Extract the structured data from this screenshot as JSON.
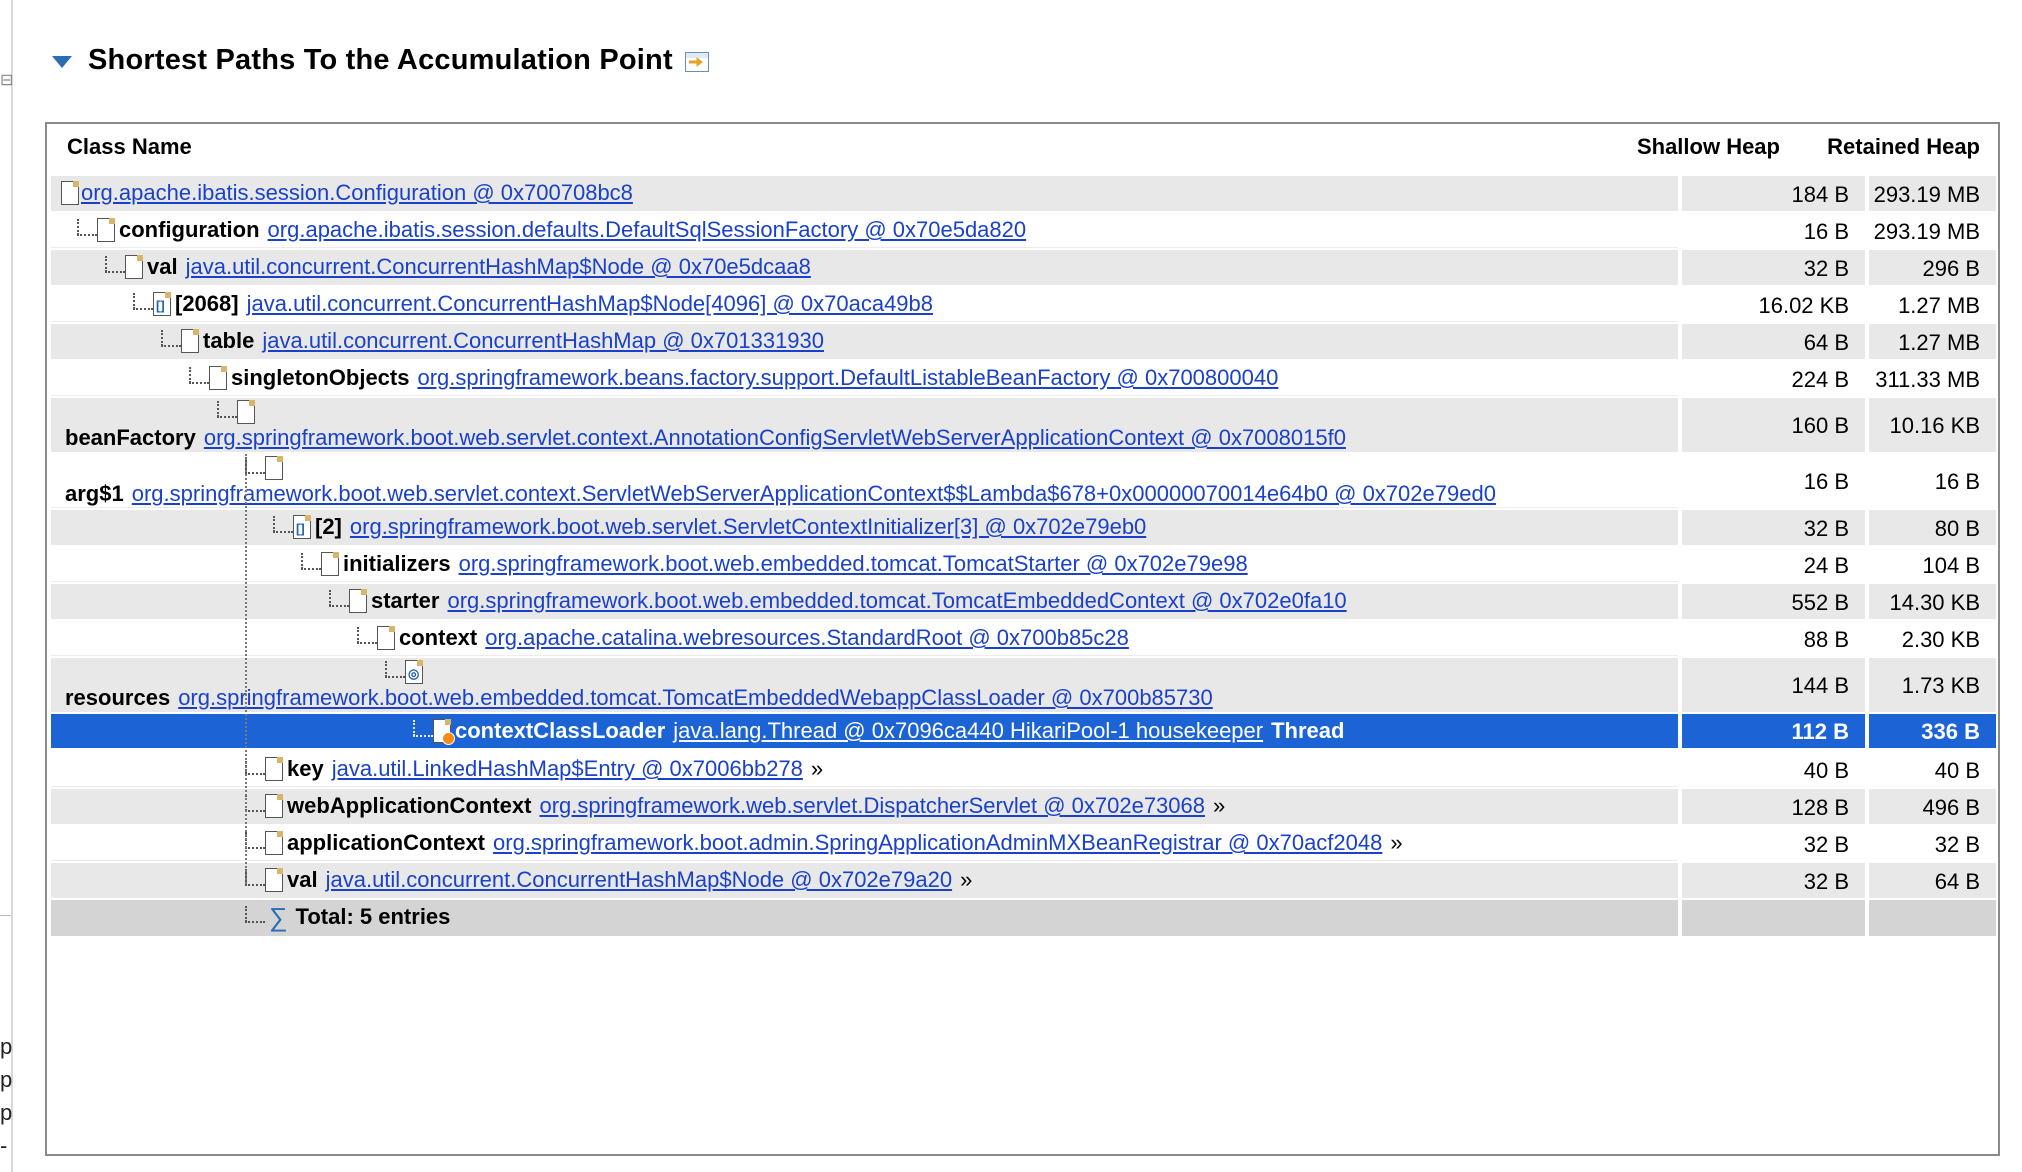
{
  "section": {
    "title": "Shortest Paths To the Accumulation Point"
  },
  "left_strip": {
    "chars": [
      "p",
      "p",
      "p",
      "-"
    ]
  },
  "columns": {
    "class_name": "Class Name",
    "shallow_heap": "Shallow Heap",
    "retained_heap": "Retained Heap"
  },
  "rows": [
    {
      "field": "",
      "object": "org.apache.ibatis.session.Configuration @ 0x700708bc8",
      "shallow": "184 B",
      "retained": "293.19 MB",
      "icon": "object-icon"
    },
    {
      "field": "configuration",
      "object": "org.apache.ibatis.session.defaults.DefaultSqlSessionFactory @ 0x70e5da820",
      "shallow": "16 B",
      "retained": "293.19 MB",
      "icon": "object-icon"
    },
    {
      "field": "val",
      "object": "java.util.concurrent.ConcurrentHashMap$Node @ 0x70e5dcaa8",
      "shallow": "32 B",
      "retained": "296 B",
      "icon": "object-icon"
    },
    {
      "field": "[2068]",
      "object": "java.util.concurrent.ConcurrentHashMap$Node[4096] @ 0x70aca49b8",
      "shallow": "16.02 KB",
      "retained": "1.27 MB",
      "icon": "array-icon"
    },
    {
      "field": "table",
      "object": "java.util.concurrent.ConcurrentHashMap @ 0x701331930",
      "shallow": "64 B",
      "retained": "1.27 MB",
      "icon": "object-icon"
    },
    {
      "field": "singletonObjects",
      "object": "org.springframework.beans.factory.support.DefaultListableBeanFactory @ 0x700800040",
      "shallow": "224 B",
      "retained": "311.33 MB",
      "icon": "object-icon"
    },
    {
      "field": "beanFactory",
      "object": "org.springframework.boot.web.servlet.context.AnnotationConfigServletWebServerApplicationContext @ 0x7008015f0",
      "shallow": "160 B",
      "retained": "10.16 KB",
      "icon": "object-icon"
    },
    {
      "field": "arg$1",
      "object": "org.springframework.boot.web.servlet.context.ServletWebServerApplicationContext$$Lambda$678+0x00000070014e64b0 @ 0x702e79ed0",
      "shallow": "16 B",
      "retained": "16 B",
      "icon": "object-icon"
    },
    {
      "field": "[2]",
      "object": "org.springframework.boot.web.servlet.ServletContextInitializer[3] @ 0x702e79eb0",
      "shallow": "32 B",
      "retained": "80 B",
      "icon": "array-icon"
    },
    {
      "field": "initializers",
      "object": "org.springframework.boot.web.embedded.tomcat.TomcatStarter @ 0x702e79e98",
      "shallow": "24 B",
      "retained": "104 B",
      "icon": "object-icon"
    },
    {
      "field": "starter",
      "object": "org.springframework.boot.web.embedded.tomcat.TomcatEmbeddedContext @ 0x702e0fa10",
      "shallow": "552 B",
      "retained": "14.30 KB",
      "icon": "object-icon"
    },
    {
      "field": "context",
      "object": "org.apache.catalina.webresources.StandardRoot @ 0x700b85c28",
      "shallow": "88 B",
      "retained": "2.30 KB",
      "icon": "object-icon"
    },
    {
      "field": "resources",
      "object": "org.springframework.boot.web.embedded.tomcat.TomcatEmbeddedWebappClassLoader @ 0x700b85730",
      "shallow": "144 B",
      "retained": "1.73 KB",
      "icon": "classloader-icon"
    },
    {
      "field": "contextClassLoader",
      "object": "java.lang.Thread @ 0x7096ca440 HikariPool-1 housekeeper",
      "suffix": "Thread",
      "shallow": "112 B",
      "retained": "336 B",
      "icon": "thread-icon"
    },
    {
      "field": "key",
      "object": "java.util.LinkedHashMap$Entry @ 0x7006bb278",
      "more": "»",
      "shallow": "40 B",
      "retained": "40 B",
      "icon": "object-icon"
    },
    {
      "field": "webApplicationContext",
      "object": "org.springframework.web.servlet.DispatcherServlet @ 0x702e73068",
      "more": "»",
      "shallow": "128 B",
      "retained": "496 B",
      "icon": "object-icon"
    },
    {
      "field": "applicationContext",
      "object": "org.springframework.boot.admin.SpringApplicationAdminMXBeanRegistrar @ 0x70acf2048",
      "more": "»",
      "shallow": "32 B",
      "retained": "32 B",
      "icon": "object-icon"
    },
    {
      "field": "val",
      "object": "java.util.concurrent.ConcurrentHashMap$Node @ 0x702e79a20",
      "more": "»",
      "shallow": "32 B",
      "retained": "64 B",
      "icon": "object-icon"
    },
    {
      "field": "Total: 5 entries",
      "object": "",
      "shallow": "",
      "retained": "",
      "icon": "sum-icon"
    }
  ]
}
